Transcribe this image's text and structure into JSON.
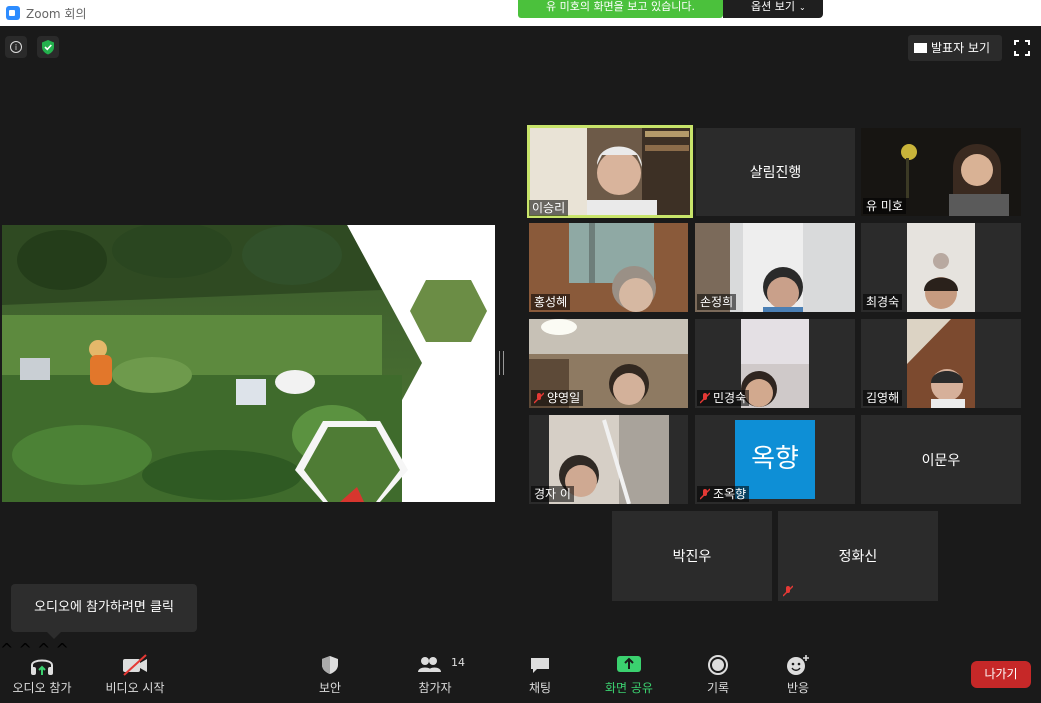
{
  "window": {
    "title": "Zoom 회의"
  },
  "share_banner": {
    "text": "유 미호의 화면을 보고 있습니다.",
    "color": "#4bc13c"
  },
  "view_options": {
    "label": "옵션 보기"
  },
  "top_right": {
    "speaker_view_label": "발표자 보기"
  },
  "tiles": [
    {
      "name": "이승리",
      "video": true,
      "active_speaker": true,
      "muted": false
    },
    {
      "name": "살림진행",
      "video": false,
      "muted": false
    },
    {
      "name": "유 미호",
      "video": true,
      "muted": false
    },
    {
      "name": "홍성혜",
      "video": true,
      "muted": false
    },
    {
      "name": "손정희",
      "video": true,
      "muted": false
    },
    {
      "name": "최경숙",
      "video": true,
      "muted": false
    },
    {
      "name": "양영일",
      "video": true,
      "muted": true
    },
    {
      "name": "민경숙",
      "video": true,
      "muted": true
    },
    {
      "name": "김영해",
      "video": true,
      "muted": false
    },
    {
      "name": "경자 이",
      "video": true,
      "muted": false
    },
    {
      "name": "조옥향",
      "video": true,
      "muted": true,
      "avatar_text": "옥향"
    },
    {
      "name": "이문우",
      "video": false,
      "muted": false
    },
    {
      "name": "박진우",
      "video": false,
      "muted": false
    },
    {
      "name": "정화신",
      "video": false,
      "muted": true
    }
  ],
  "tooltip": {
    "text": "오디오에 참가하려면 클릭"
  },
  "toolbar": {
    "join_audio": "오디오 참가",
    "start_video": "비디오 시작",
    "security": "보안",
    "participants": "참가자",
    "participants_count": "14",
    "chat": "채팅",
    "share_screen": "화면 공유",
    "record": "기록",
    "reactions": "반응",
    "leave": "나가기"
  },
  "colors": {
    "accent_green": "#3bd16f",
    "leave_red": "#c62828",
    "active_outline": "#c8e46a",
    "avatar_blue": "#0e8fd6"
  }
}
